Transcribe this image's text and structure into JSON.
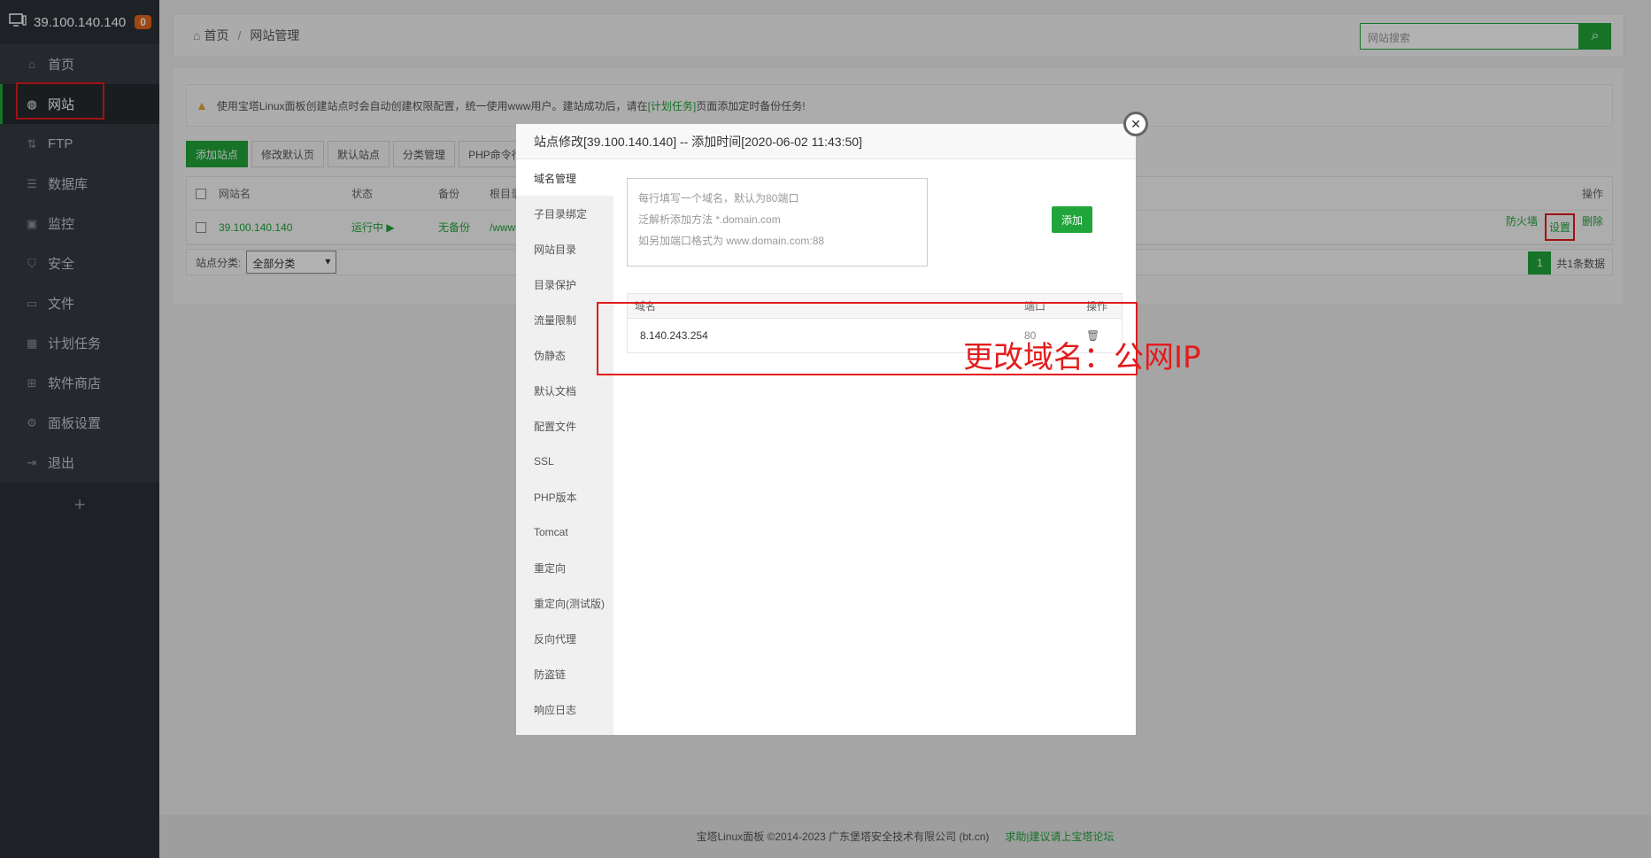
{
  "sidebar": {
    "server_ip": "39.100.140.140",
    "badge": "0",
    "items": [
      {
        "label": "首页",
        "icon": "home-icon"
      },
      {
        "label": "网站",
        "icon": "globe-icon"
      },
      {
        "label": "FTP",
        "icon": "ftp-icon"
      },
      {
        "label": "数据库",
        "icon": "database-icon"
      },
      {
        "label": "监控",
        "icon": "monitor-icon"
      },
      {
        "label": "安全",
        "icon": "shield-icon"
      },
      {
        "label": "文件",
        "icon": "folder-icon"
      },
      {
        "label": "计划任务",
        "icon": "calendar-icon"
      },
      {
        "label": "软件商店",
        "icon": "grid-icon"
      },
      {
        "label": "面板设置",
        "icon": "gear-icon"
      },
      {
        "label": "退出",
        "icon": "logout-icon"
      }
    ],
    "plus": "+"
  },
  "breadcrumb": {
    "home": "首页",
    "sep": "/",
    "current": "网站管理"
  },
  "search": {
    "placeholder": "网站搜索"
  },
  "notice": {
    "text_before": "使用宝塔Linux面板创建站点时会自动创建权限配置，统一使用www用户。建站成功后，请在",
    "link": "[计划任务]",
    "text_after": "页面添加定时备份任务!"
  },
  "toolbar": {
    "buttons": [
      "添加站点",
      "修改默认页",
      "默认站点",
      "分类管理",
      "PHP命令行"
    ]
  },
  "table": {
    "headers": {
      "name": "网站名",
      "status": "状态",
      "backup": "备份",
      "root": "根目录",
      "ops": "操作"
    },
    "row": {
      "name": "39.100.140.140",
      "status": "运行中 ▶",
      "backup": "无备份",
      "root": "/www",
      "firewall": "防火墙",
      "settings": "设置",
      "delete": "删除"
    }
  },
  "filter": {
    "label": "站点分类:",
    "selected": "全部分类"
  },
  "pager": {
    "page": "1",
    "total": "共1条数据"
  },
  "footer": {
    "copyright": "宝塔Linux面板 ©2014-2023 广东堡塔安全技术有限公司 (bt.cn)",
    "link": "求助|建议请上宝塔论坛"
  },
  "modal": {
    "title": "站点修改[39.100.140.140] -- 添加时间[2020-06-02 11:43:50]",
    "close": "✕",
    "nav": [
      "域名管理",
      "子目录绑定",
      "网站目录",
      "目录保护",
      "流量限制",
      "伪静态",
      "默认文档",
      "配置文件",
      "SSL",
      "PHP版本",
      "Tomcat",
      "重定向",
      "重定向(测试版)",
      "反向代理",
      "防盗链",
      "响应日志"
    ],
    "textarea_hint": [
      "每行填写一个域名，默认为80端口",
      "泛解析添加方法 *.domain.com",
      "如另加端口格式为 www.domain.com:88"
    ],
    "add_button": "添加",
    "domain_table": {
      "headers": {
        "domain": "域名",
        "port": "端口",
        "ops": "操作"
      },
      "row": {
        "domain": "8.140.243.254",
        "port": "80"
      }
    }
  },
  "annotation": "更改域名：公网IP",
  "colors": {
    "brand": "#20a53a",
    "annotation": "#e31c1c",
    "sidebar": "#2c3138"
  }
}
